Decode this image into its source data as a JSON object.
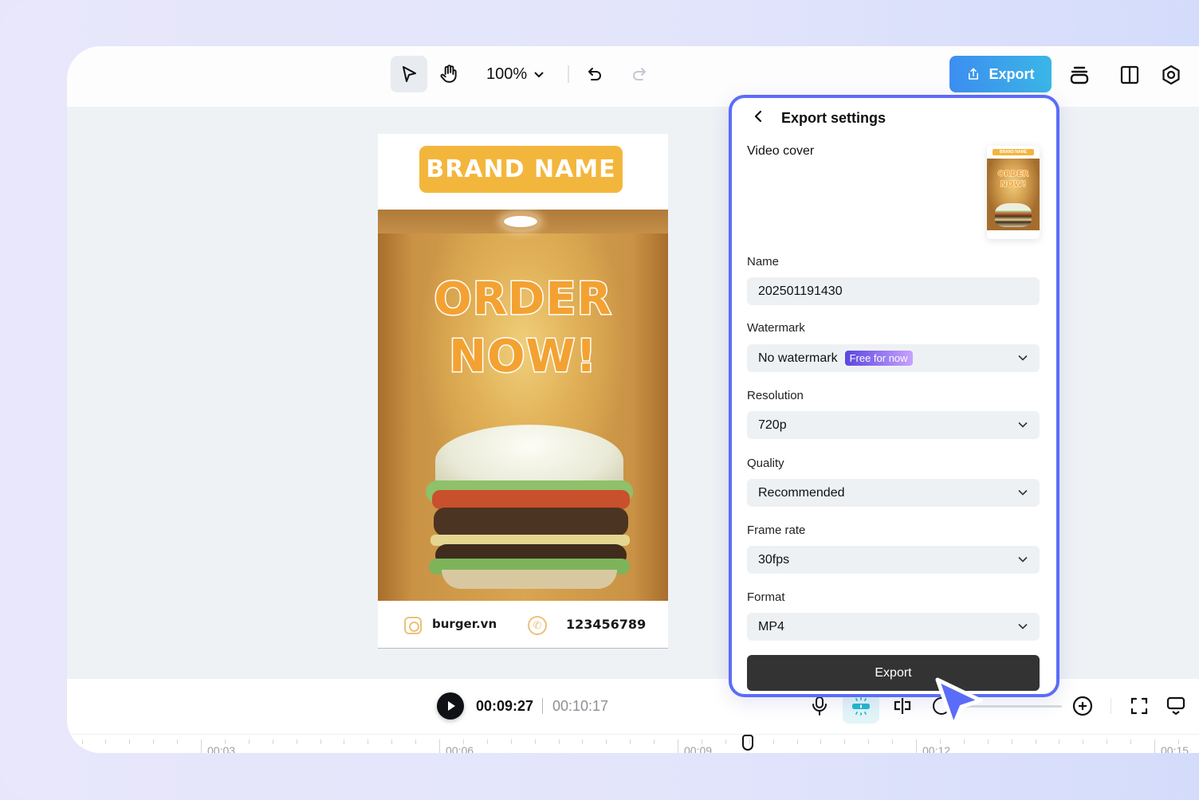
{
  "toolbar": {
    "select_tool": "select",
    "hand_tool": "hand",
    "zoom_level": "100%",
    "undo": "undo",
    "redo": "redo",
    "export_label": "Export"
  },
  "poster": {
    "brand_name": "BRAND NAME",
    "headline_line1": "ORDER",
    "headline_line2": "NOW!",
    "website": "burger.vn",
    "phone": "123456789",
    "accent_color": "#f3b63c",
    "headline_color": "#f3a232"
  },
  "export_panel": {
    "title": "Export settings",
    "video_cover_label": "Video cover",
    "cover_thumb": {
      "brand_name": "BRAND NAME",
      "line1": "ORDER",
      "line2": "NOW!"
    },
    "fields": {
      "name": {
        "label": "Name",
        "value": "202501191430"
      },
      "watermark": {
        "label": "Watermark",
        "value": "No watermark",
        "badge": "Free for now"
      },
      "resolution": {
        "label": "Resolution",
        "value": "720p"
      },
      "quality": {
        "label": "Quality",
        "value": "Recommended"
      },
      "frame_rate": {
        "label": "Frame rate",
        "value": "30fps"
      },
      "format": {
        "label": "Format",
        "value": "MP4"
      }
    },
    "export_button": "Export",
    "border_color": "#5b6cf8"
  },
  "playback": {
    "current_time": "00:09:27",
    "total_time": "00:10:17"
  },
  "timeline": {
    "labels": [
      "00:03",
      "00:06",
      "00:09",
      "00:12",
      "00:15"
    ]
  }
}
